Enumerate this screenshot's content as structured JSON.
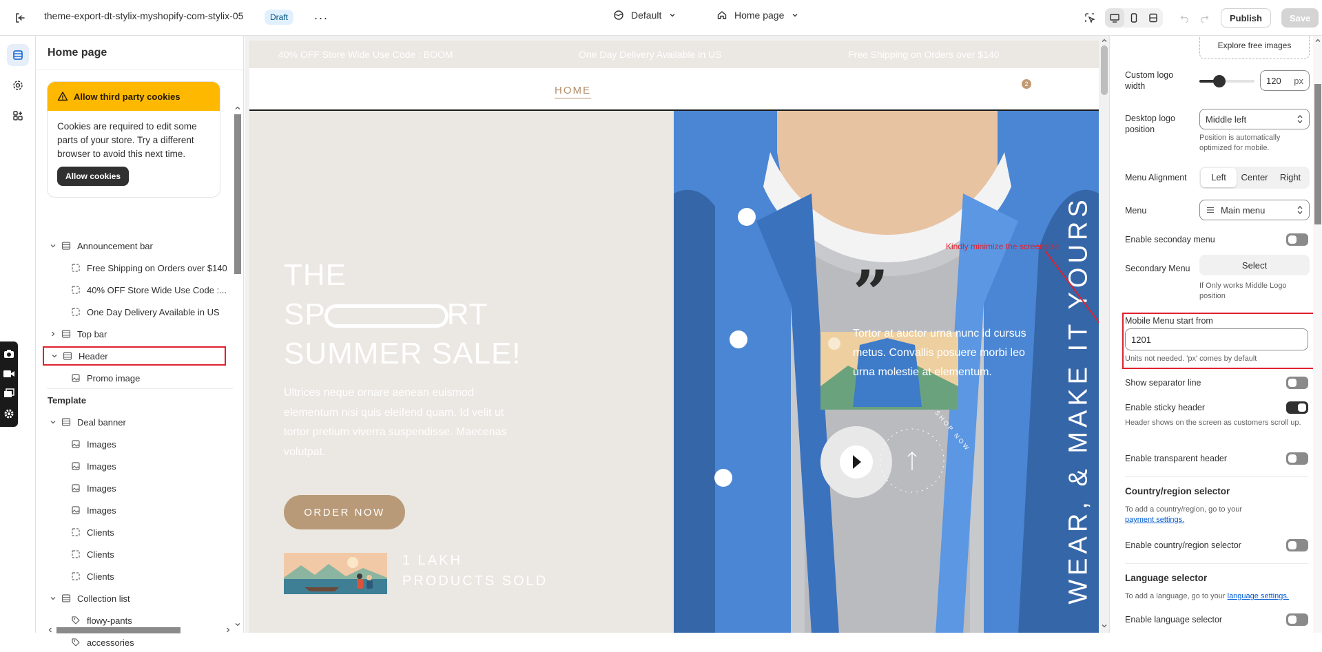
{
  "topbar": {
    "theme_name": "theme-export-dt-stylix-myshopify-com-stylix-05",
    "draft_badge": "Draft",
    "more_label": "···",
    "theme_setting": "Default",
    "page_selector": "Home page",
    "publish_label": "Publish",
    "save_label": "Save"
  },
  "sidebar": {
    "title": "Home page",
    "cookie_banner": {
      "title": "Allow third party cookies",
      "body": "Cookies are required to edit some parts of your store. Try a different browser to avoid this next time.",
      "button": "Allow cookies"
    },
    "header_group": [
      {
        "label": "Announcement bar"
      },
      {
        "label": "Free Shipping on Orders over $140"
      },
      {
        "label": "40% OFF Store Wide Use Code :..."
      },
      {
        "label": "One Day Delivery Available in US"
      },
      {
        "label": "Top bar"
      },
      {
        "label": "Header"
      },
      {
        "label": "Promo image"
      }
    ],
    "template_section": "Template",
    "template_items": [
      {
        "label": "Deal banner"
      },
      {
        "label": "Images"
      },
      {
        "label": "Images"
      },
      {
        "label": "Images"
      },
      {
        "label": "Images"
      },
      {
        "label": "Clients"
      },
      {
        "label": "Clients"
      },
      {
        "label": "Clients"
      },
      {
        "label": "Collection list"
      },
      {
        "label": "flowy-pants"
      },
      {
        "label": "accessories"
      }
    ]
  },
  "preview": {
    "announcements": [
      "40% OFF Store Wide Use Code : BOOM",
      "One Day Delivery Available in US",
      "Free Shipping on Orders over $140"
    ],
    "nav_home": "HOME",
    "cart_count": "2",
    "hero_title_1": "THE",
    "hero_title_2a": "SP",
    "hero_title_2b": "RT",
    "hero_title_3": "SUMMER SALE!",
    "hero_subtitle": "Ultrices neque ornare aenean euismod elementum nisi quis eleifend quam. Id velit ut tortor pretium viverra suspendisse. Maecenas volutpat.",
    "hero_button": "ORDER NOW",
    "hero_stat": "1 LAKH PRODUCTS SOLD",
    "quote_text": "Tortor at auctor urna nunc id cursus metus. Convallis posuere morbi leo urna molestie at elementum.",
    "vertical_text": "WEAR, & MAKE IT YOURS",
    "shop_now": "SHOP NOW",
    "annotation": "Kindly minimize the screensize"
  },
  "panel": {
    "explore_images": "Explore free images",
    "logo_width_label": "Custom logo width",
    "logo_width_value": "120",
    "logo_width_unit": "px",
    "logo_width_fraction": 0.36,
    "desktop_logo_label": "Desktop logo position",
    "desktop_logo_value": "Middle left",
    "desktop_logo_note": "Position is automatically optimized for mobile.",
    "menu_alignment_label": "Menu Alignment",
    "menu_alignment_options": [
      "Left",
      "Center",
      "Right"
    ],
    "menu_alignment_selected": "Left",
    "menu_label": "Menu",
    "menu_value": "Main menu",
    "secondary_menu_toggle": "Enable seconday menu",
    "secondary_menu_label": "Secondary Menu",
    "secondary_menu_button": "Select",
    "secondary_menu_note": "If Only works Middle Logo position",
    "mobile_menu_label": "Mobile Menu start from",
    "mobile_menu_value": "1201",
    "mobile_menu_note": "Units not needed. 'px' comes by default",
    "separator_label": "Show separator line",
    "sticky_label": "Enable sticky header",
    "sticky_note": "Header shows on the screen as customers scroll up.",
    "transparent_label": "Enable transparent header",
    "country_heading": "Country/region selector",
    "country_note": "To add a country/region, go to your",
    "country_link": "payment settings.",
    "country_toggle": "Enable country/region selector",
    "language_heading": "Language selector",
    "language_note": "To add a language, go to your",
    "language_link": "language settings.",
    "language_toggle": "Enable language selector"
  }
}
